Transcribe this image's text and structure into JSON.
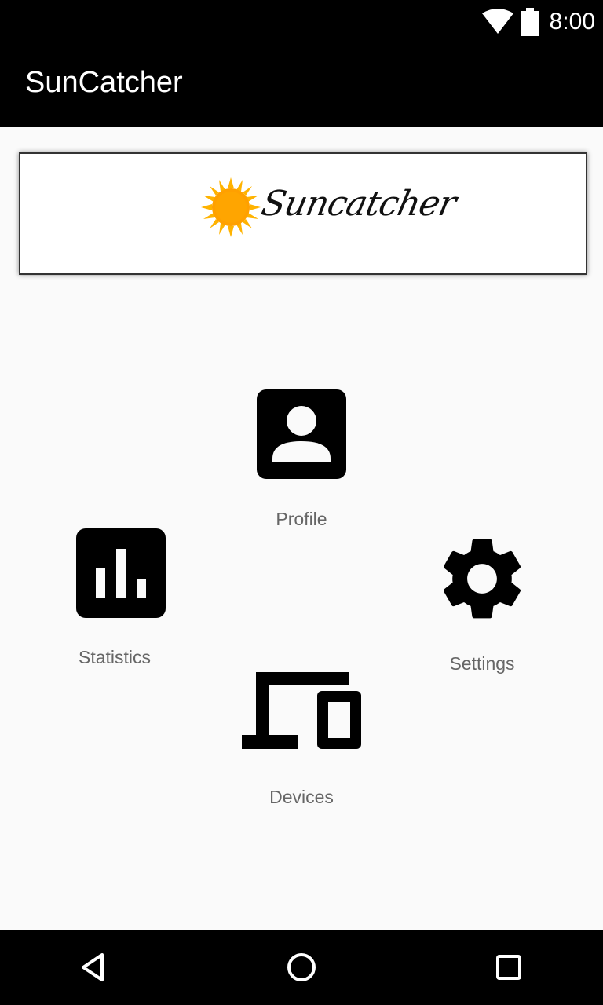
{
  "status_bar": {
    "time": "8:00",
    "icons": [
      "wifi-icon",
      "battery-icon"
    ]
  },
  "app_bar": {
    "title": "SunCatcher"
  },
  "banner": {
    "logo_text": "Suncatcher",
    "logo_icon": "sun-icon",
    "sun_color": "#FFA500"
  },
  "menu": {
    "profile": {
      "label": "Profile",
      "icon": "account-box-icon"
    },
    "statistics": {
      "label": "Statistics",
      "icon": "bar-chart-icon"
    },
    "settings": {
      "label": "Settings",
      "icon": "gear-icon"
    },
    "devices": {
      "label": "Devices",
      "icon": "devices-icon"
    }
  },
  "nav_bar": {
    "buttons": [
      "back-icon",
      "home-icon",
      "recents-icon"
    ]
  },
  "colors": {
    "bars": "#000000",
    "background": "#FAFAFA",
    "label_text": "#666666"
  }
}
